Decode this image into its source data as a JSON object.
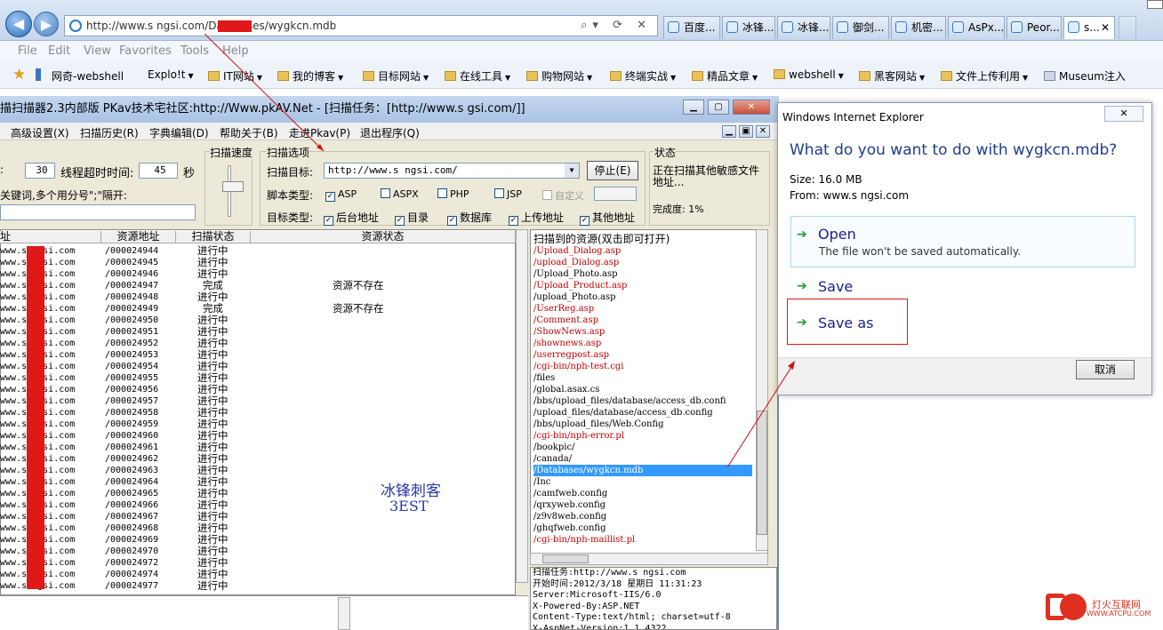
{
  "browser": {
    "address": "http://www.s    ngsi.com/Databases/wygkcn.mdb",
    "address_tools": "⌕▾ ⟳ ✕",
    "tabs": [
      "百度...",
      "冰锋...",
      "冰锋...",
      "御剑...",
      "机密...",
      "AsPx...",
      "Peor...",
      "s..."
    ],
    "menu": [
      "File",
      "Edit",
      "Favorites",
      "Tools",
      "Help"
    ],
    "favorites": [
      "网奇-webshell",
      "Explo!t",
      "IT网站",
      "我的博客",
      "目标网站",
      "在线工具",
      "购物网站",
      "终端实战",
      "精品文章",
      "webshell",
      "黑客网站",
      "文件上传利用",
      "Museum注入"
    ]
  },
  "scanner": {
    "title": "描扫描器2.3内部版   PKav技术宅社区:http://Www.pkAV.Net - [扫描任务：[http://www.s       gsi.com/]]",
    "menu": [
      "高级设置(X)",
      "扫描历史(R)",
      "字典编辑(D)",
      "帮助关于(B)",
      "走进Pkav(P)",
      "退出程序(Q)"
    ],
    "threads_label": ":",
    "threads_value": "30",
    "timeout_label": "线程超时时间:",
    "timeout_value": "45",
    "timeout_unit": "秒",
    "keyword_label": "关键词,多个用分号\";\"隔开:",
    "speed_label": "扫描速度",
    "options_label": "扫描选项",
    "target_label": "扫描目标:",
    "target_value": "http://www.s     ngsi.com/",
    "stop_button": "停止(E)",
    "script_label": "脚本类型:",
    "script_types": [
      "ASP",
      "ASPX",
      "PHP",
      "JSP",
      "自定义"
    ],
    "target_type_label": "目标类型:",
    "target_types": [
      "后台地址",
      "目录",
      "数据库",
      "上传地址",
      "其他地址"
    ],
    "status_label": "状态",
    "status_text": "正在扫描其他敏感文件地址...",
    "progress_text": "完成度: 1%",
    "columns": [
      "址",
      "资源地址",
      "扫描状态",
      "资源状态"
    ],
    "rows": [
      [
        "www.s    ngsi.com",
        "/000024944",
        "进行中",
        ""
      ],
      [
        "www.s    ngsi.com",
        "/000024945",
        "进行中",
        ""
      ],
      [
        "www.s    ngsi.com",
        "/000024946",
        "进行中",
        ""
      ],
      [
        "www.s    ngsi.com",
        "/000024947",
        "完成",
        "资源不存在"
      ],
      [
        "www.s    ngsi.com",
        "/000024948",
        "进行中",
        ""
      ],
      [
        "www.s    ngsi.com",
        "/000024949",
        "完成",
        "资源不存在"
      ],
      [
        "www.s    ngsi.com",
        "/000024950",
        "进行中",
        ""
      ],
      [
        "www.s    ngsi.com",
        "/000024951",
        "进行中",
        ""
      ],
      [
        "www.s    ngsi.com",
        "/000024952",
        "进行中",
        ""
      ],
      [
        "www.s    ngsi.com",
        "/000024953",
        "进行中",
        ""
      ],
      [
        "www.s    ngsi.com",
        "/000024954",
        "进行中",
        ""
      ],
      [
        "www.s    ngsi.com",
        "/000024955",
        "进行中",
        ""
      ],
      [
        "www.s    ngsi.com",
        "/000024956",
        "进行中",
        ""
      ],
      [
        "www.s    ngsi.com",
        "/000024957",
        "进行中",
        ""
      ],
      [
        "www.s    ngsi.com",
        "/000024958",
        "进行中",
        ""
      ],
      [
        "www.s    ngsi.com",
        "/000024959",
        "进行中",
        ""
      ],
      [
        "www.s    ngsi.com",
        "/000024960",
        "进行中",
        ""
      ],
      [
        "www.s    ngsi.com",
        "/000024961",
        "进行中",
        ""
      ],
      [
        "www.s    ngsi.com",
        "/000024962",
        "进行中",
        ""
      ],
      [
        "www.s    ngsi.com",
        "/000024963",
        "进行中",
        ""
      ],
      [
        "www.s    ngsi.com",
        "/000024964",
        "进行中",
        ""
      ],
      [
        "www.s    ngsi.com",
        "/000024965",
        "进行中",
        ""
      ],
      [
        "www.s    ngsi.com",
        "/000024966",
        "进行中",
        ""
      ],
      [
        "www.s    ngsi.com",
        "/000024967",
        "进行中",
        ""
      ],
      [
        "www.s    ngsi.com",
        "/000024968",
        "进行中",
        ""
      ],
      [
        "www.s    ngsi.com",
        "/000024969",
        "进行中",
        ""
      ],
      [
        "www.s    ngsi.com",
        "/000024970",
        "进行中",
        ""
      ],
      [
        "www.s    ngsi.com",
        "/000024972",
        "进行中",
        ""
      ],
      [
        "www.s    ngsi.com",
        "/000024974",
        "进行中",
        ""
      ],
      [
        "www.s    ngsi.com",
        "/000024977",
        "进行中",
        ""
      ]
    ],
    "watermark_1": "冰锋刺客",
    "watermark_2": "3EST",
    "found_header": "扫描到的资源(双击即可打开)",
    "found": [
      {
        "t": "/Upload_Dialog.asp",
        "c": "red"
      },
      {
        "t": "/upload_Dialog.asp",
        "c": "red"
      },
      {
        "t": "/Upload_Photo.asp",
        "c": ""
      },
      {
        "t": "/Upload_Product.asp",
        "c": "red"
      },
      {
        "t": "/upload_Photo.asp",
        "c": ""
      },
      {
        "t": "/UserReg.asp",
        "c": "red"
      },
      {
        "t": "/Comment.asp",
        "c": "red"
      },
      {
        "t": "/ShowNews.asp",
        "c": "red"
      },
      {
        "t": "/shownews.asp",
        "c": "red"
      },
      {
        "t": "/userregpost.asp",
        "c": "red"
      },
      {
        "t": "/cgi-bin/nph-test.cgi",
        "c": "red"
      },
      {
        "t": "/files",
        "c": ""
      },
      {
        "t": "/global.asax.cs",
        "c": ""
      },
      {
        "t": "/bbs/upload_files/database/access_db.confi",
        "c": ""
      },
      {
        "t": "/upload_files/database/access_db.config",
        "c": ""
      },
      {
        "t": "/bbs/upload_files/Web.Config",
        "c": ""
      },
      {
        "t": "/cgi-bin/nph-error.pl",
        "c": "red"
      },
      {
        "t": "/bookpic/",
        "c": ""
      },
      {
        "t": "/canada/",
        "c": ""
      },
      {
        "t": "/Databases/wygkcn.mdb",
        "c": "sel"
      },
      {
        "t": "/Inc",
        "c": ""
      },
      {
        "t": "/camfweb.config",
        "c": ""
      },
      {
        "t": "/qrxyweb.config",
        "c": ""
      },
      {
        "t": "/z9v8web.config",
        "c": ""
      },
      {
        "t": "/ghqfweb.config",
        "c": ""
      },
      {
        "t": "/cgi-bin/nph-maillist.pl",
        "c": "red"
      }
    ],
    "info": [
      "扫描任务:http://www.s     ngsi.com",
      "开始时间:2012/3/18 星期日 11:31:23",
      "Server:Microsoft-IIS/6.0",
      "X-Powered-By:ASP.NET",
      "Content-Type:text/html; charset=utf-8",
      "X-AspNet-Version:1.1.4322"
    ]
  },
  "dialog": {
    "title": "Windows Internet Explorer",
    "question": "What do you want to do with wygkcn.mdb?",
    "size": "Size: 16.0 MB",
    "from": "From: www.s     ngsi.com",
    "open_label": "Open",
    "open_note": "The file won't be saved automatically.",
    "save_label": "Save",
    "saveas_label": "Save as",
    "cancel_label": "取消"
  },
  "watermark": {
    "site_name": "灯火互联网",
    "site_url": "WWW.ATCPU.COM"
  },
  "colors": {
    "accent_red": "#e01818",
    "selection": "#3399ff"
  }
}
